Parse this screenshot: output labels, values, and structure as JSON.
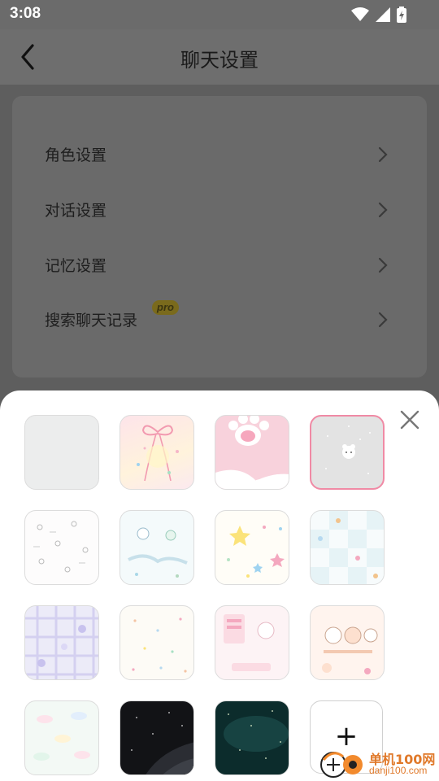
{
  "status": {
    "time": "3:08"
  },
  "header": {
    "title": "聊天设置"
  },
  "settings": {
    "items": [
      {
        "label": "角色设置"
      },
      {
        "label": "对话设置"
      },
      {
        "label": "记忆设置"
      },
      {
        "label": "搜索聊天记录",
        "badge": "pro"
      }
    ]
  },
  "backgrounds": {
    "selected_index": 3,
    "tiles": [
      {
        "name": "plain-gray"
      },
      {
        "name": "pink-bow"
      },
      {
        "name": "cat-paw-pink"
      },
      {
        "name": "gray-bear"
      },
      {
        "name": "white-doodle"
      },
      {
        "name": "mint-cat"
      },
      {
        "name": "stars"
      },
      {
        "name": "blue-check"
      },
      {
        "name": "purple-plaid"
      },
      {
        "name": "cream-dots"
      },
      {
        "name": "pink-sticker"
      },
      {
        "name": "peach-faces"
      },
      {
        "name": "pastel-clouds"
      },
      {
        "name": "night-sky"
      },
      {
        "name": "teal-galaxy"
      }
    ],
    "add_label": "+"
  },
  "watermark": {
    "line1": "单机100网",
    "line2": "danji100.com"
  },
  "colors": {
    "selected_border": "#f08aa5",
    "pro_badge": "#f2d33c",
    "watermark": "#e0792a"
  }
}
